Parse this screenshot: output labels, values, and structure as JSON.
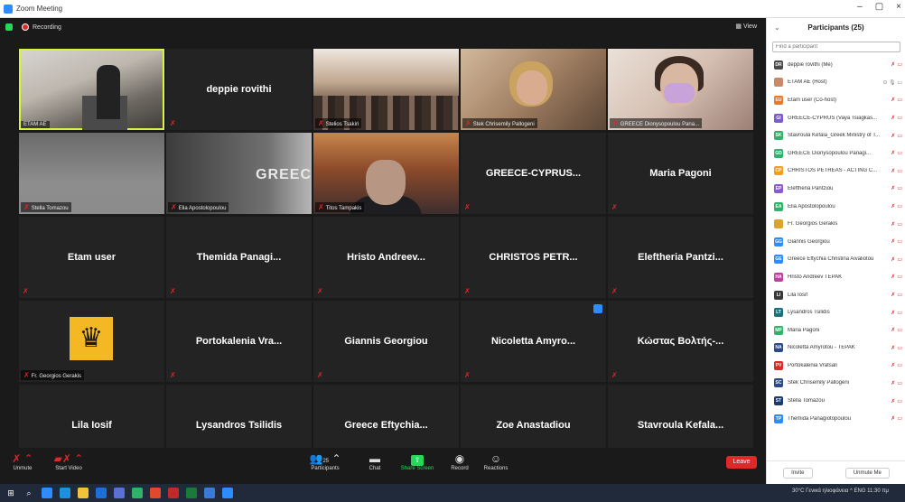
{
  "window": {
    "title": "Zoom Meeting",
    "controls": [
      "–",
      "▢",
      "×"
    ]
  },
  "meeting": {
    "recording_label": "Recording",
    "view_label": "▦ View",
    "tiles": [
      {
        "label": "ETAM AE",
        "type": "video",
        "active": true
      },
      {
        "center_name": "deppie rovithi",
        "type": "name"
      },
      {
        "label": "Stelios Tsakiri",
        "type": "video"
      },
      {
        "label": "Stek Chrisemily Pallogeni",
        "type": "video"
      },
      {
        "label": "GREECE Dionysopoulou Pana...",
        "type": "video"
      },
      {
        "label": "Stella Tomazou",
        "type": "video"
      },
      {
        "label": "Elia Apostolopoulou",
        "type": "video",
        "overlay_text": "GREEC"
      },
      {
        "label": "Titos Tampakis",
        "type": "video"
      },
      {
        "center_name": "GREECE-CYPRUS...",
        "type": "name"
      },
      {
        "center_name": "Maria Pagoni",
        "type": "name"
      },
      {
        "center_name": "Etam user",
        "type": "name"
      },
      {
        "center_name": "Themida Panagi...",
        "type": "name"
      },
      {
        "center_name": "Hristo Andreev...",
        "type": "name"
      },
      {
        "center_name": "CHRISTOS PETR...",
        "type": "name"
      },
      {
        "center_name": "Eleftheria Pantzi...",
        "type": "name"
      },
      {
        "label": "Fr. Georgios Gerakis",
        "type": "crest"
      },
      {
        "center_name": "Portokalenia Vra...",
        "type": "name"
      },
      {
        "center_name": "Giannis Georgiou",
        "type": "name"
      },
      {
        "center_name": "Nicoletta Amyro...",
        "type": "name",
        "badge": true
      },
      {
        "center_name": "Κώστας Βολτής-...",
        "type": "name"
      },
      {
        "center_name": "Lila Iosif",
        "type": "name"
      },
      {
        "center_name": "Lysandros Tsilidis",
        "type": "name"
      },
      {
        "center_name": "Greece Eftychia...",
        "type": "name"
      },
      {
        "center_name": "Zoe Anastadiou",
        "type": "name"
      },
      {
        "center_name": "Stavroula Kefala...",
        "type": "name"
      }
    ]
  },
  "toolbar": {
    "unmute": "Unmute",
    "start_video": "Start Video",
    "participants": "Participants",
    "participants_count": "25",
    "chat": "Chat",
    "share_screen": "Share Screen",
    "record": "Record",
    "reactions": "Reactions",
    "leave": "Leave"
  },
  "panel": {
    "title": "Participants (25)",
    "search_placeholder": "Find a participant",
    "participants": [
      {
        "initials": "DR",
        "color": "#4a4a4a",
        "name": "deppie rovithi (Me)"
      },
      {
        "initials": "",
        "color": "#c98a6a",
        "name": "ETAM AE (Host)",
        "gray": true
      },
      {
        "initials": "EU",
        "color": "#e8782a",
        "name": "Etam user (Co-host)"
      },
      {
        "initials": "GI",
        "color": "#7a5bd0",
        "name": "GREECE-CYPRUS (Vaya Tsiagkas..."
      },
      {
        "initials": "SK",
        "color": "#2fb36b",
        "name": "Stavroula Kefala_Greek Ministry of T..."
      },
      {
        "initials": "GD",
        "color": "#2fb36b",
        "name": "GREECE Dionysopoulou Panagi..."
      },
      {
        "initials": "CP",
        "color": "#f0a020",
        "name": "CHRISTOS PETREAS - ACTING C..."
      },
      {
        "initials": "EP",
        "color": "#8a5bd0",
        "name": "Eleftheria Pantziou"
      },
      {
        "initials": "EA",
        "color": "#2fb36b",
        "name": "Elia Apostolopoulou"
      },
      {
        "initials": "",
        "color": "#d9a52a",
        "name": "Fr. Georgios Gerakis"
      },
      {
        "initials": "GG",
        "color": "#2d8cff",
        "name": "Giannis Georgiou"
      },
      {
        "initials": "GE",
        "color": "#2d8cff",
        "name": "Greece Eftychia Christina Aivaliotou"
      },
      {
        "initials": "HA",
        "color": "#c040a0",
        "name": "Hristo Andreev TEPAK"
      },
      {
        "initials": "LI",
        "color": "#3a3a3a",
        "name": "Lila Iosif"
      },
      {
        "initials": "LT",
        "color": "#1d6f7a",
        "name": "Lysandros Tsilidis"
      },
      {
        "initials": "MP",
        "color": "#2fb36b",
        "name": "Maria Pagoni"
      },
      {
        "initials": "NA",
        "color": "#2a4a8a",
        "name": "Nicoletta Amyrotou - TEPAK"
      },
      {
        "initials": "PV",
        "color": "#e02828",
        "name": "Portokalenia Vratsali"
      },
      {
        "initials": "SC",
        "color": "#2a4a8a",
        "name": "Stek Chrisemily Pallogeni"
      },
      {
        "initials": "ST",
        "color": "#1d3a6a",
        "name": "Stella Tomazou"
      },
      {
        "initials": "TP",
        "color": "#2d8cff",
        "name": "Themida Panagiotopoulou"
      }
    ],
    "invite": "Invite",
    "unmute_me": "Unmute Me"
  },
  "taskbar": {
    "tray_text": "30°C Γενικά ηλιοφάνεια  ^  ENG  11:30 πμ"
  }
}
